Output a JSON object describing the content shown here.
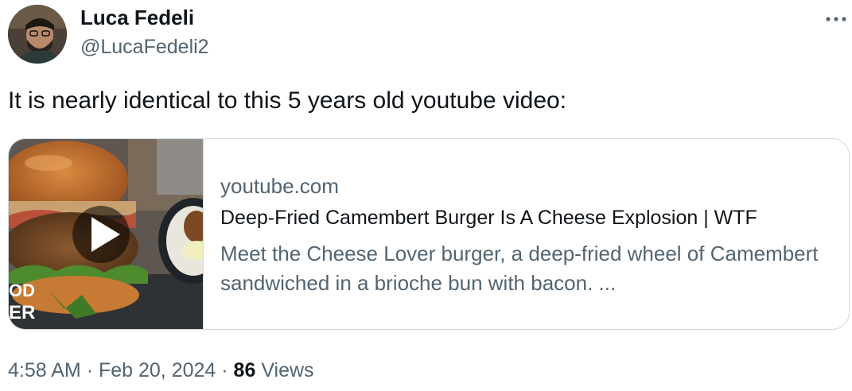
{
  "author": {
    "name": "Luca Fedeli",
    "handle": "@LucaFedeli2"
  },
  "tweet": {
    "text": "It is nearly identical to this 5 years old youtube video:"
  },
  "card": {
    "domain": "youtube.com",
    "title": "Deep-Fried Camembert Burger Is A Cheese Explosion | WTF",
    "description": "Meet the Cheese Lover burger, a deep-fried wheel of Camembert sandwiched in a brioche bun with bacon. ...",
    "thumbnail_watermark_line1": "OD",
    "thumbnail_watermark_line2": "ER"
  },
  "meta": {
    "time": "4:58 AM",
    "separator": "·",
    "date": "Feb 20, 2024",
    "views_count": "86",
    "views_label": "Views"
  },
  "icons": {
    "more": "more-dots-icon",
    "play": "play-icon"
  },
  "colors": {
    "text_primary": "#0f1419",
    "text_secondary": "#536471",
    "border": "#cfd9de"
  }
}
